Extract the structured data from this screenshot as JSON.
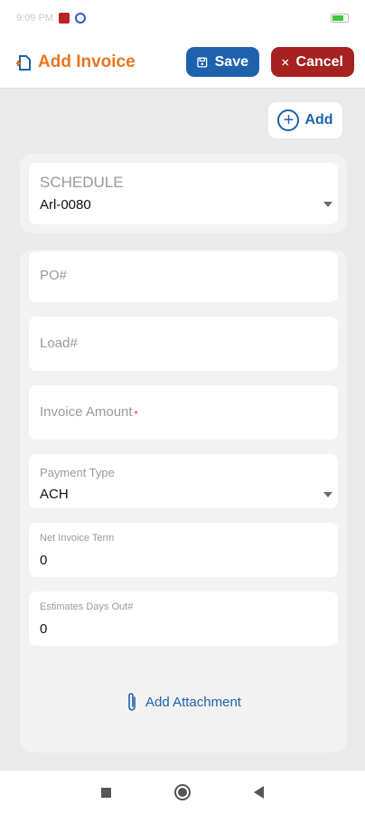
{
  "status_bar": {
    "time": "9:09 PM",
    "indicators": ""
  },
  "header": {
    "title": "Add Invoice",
    "title_icon": "document-add-icon",
    "save_label": "Save",
    "cancel_label": "Cancel"
  },
  "add_button": {
    "label": "Add",
    "icon": "plus-circle-icon"
  },
  "schedule": {
    "label": "SCHEDULE",
    "value": "Arl-0080"
  },
  "form": {
    "po": {
      "placeholder": "PO#"
    },
    "load": {
      "placeholder": "Load#"
    },
    "invoice_amount": {
      "placeholder": "Invoice Amount",
      "required_mark": "*"
    },
    "payment_type": {
      "label": "Payment Type",
      "value": "ACH"
    },
    "net_invoice_term": {
      "label": "Net Invoice Term",
      "value": "0"
    },
    "estimates_days_out": {
      "label": "Estimates Days Out#",
      "value": "0"
    }
  },
  "attachment": {
    "label": "Add Attachment",
    "icon": "paperclip-icon"
  },
  "colors": {
    "accent_orange": "#e8761f",
    "primary_blue": "#1e62ad",
    "cancel_red": "#a52220",
    "required_red": "#d21f1f",
    "background": "#eaeaea"
  }
}
